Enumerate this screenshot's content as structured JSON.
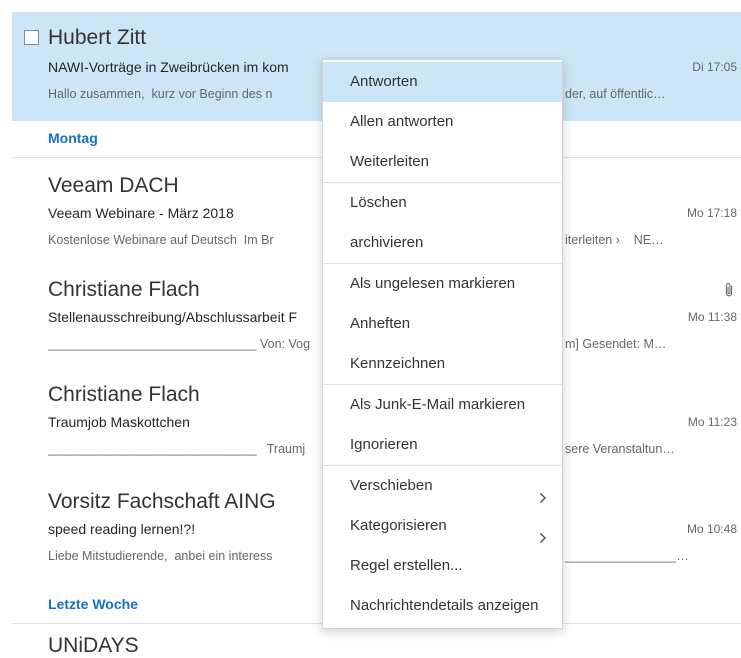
{
  "colors": {
    "accent": "#1570c6",
    "selection": "#cde6f7",
    "text": "#333333",
    "muted": "#666666"
  },
  "icons": {
    "attachment": "paperclip-icon",
    "submenu": "chevron-right-icon"
  },
  "message_list": {
    "selected_message": {
      "sender": "Hubert Zitt",
      "subject": "NAWI-Vorträge in Zweibrücken im kom",
      "time": "Di 17:05",
      "preview": "Hallo zusammen,  kurz vor Beginn des n",
      "preview_tail": "der, auf öffentlic…"
    },
    "groups": [
      {
        "label": "Montag",
        "messages": [
          {
            "sender": "Veeam DACH",
            "subject": "Veeam Webinare - März 2018",
            "time": "Mo 17:18",
            "preview": "Kostenlose Webinare auf Deutsch  Im Br",
            "preview_tail": "iterleiten ›    NE…"
          },
          {
            "sender": "Christiane Flach",
            "subject": "Stellenausschreibung/Abschlussarbeit F",
            "time": "Mo 11:38",
            "preview": "______________________________ Von: Vog",
            "preview_tail": "m] Gesendet: M…",
            "has_attachment": true
          },
          {
            "sender": "Christiane Flach",
            "subject": "Traumjob Maskottchen",
            "time": "Mo 11:23",
            "preview": "______________________________   Traumj",
            "preview_tail": "sere Veranstaltun…"
          },
          {
            "sender": "Vorsitz Fachschaft AING",
            "subject": "speed reading lernen!?!",
            "time": "Mo 10:48",
            "preview": "Liebe Mitstudierende,  anbei ein interess",
            "preview_tail": "________________…"
          }
        ]
      },
      {
        "label": "Letzte Woche",
        "messages": [
          {
            "sender": "UNiDAYS"
          }
        ]
      }
    ]
  },
  "context_menu": {
    "items": [
      {
        "label": "Antworten"
      },
      {
        "label": "Allen antworten"
      },
      {
        "label": "Weiterleiten"
      },
      {
        "label": "Löschen"
      },
      {
        "label": "archivieren"
      },
      {
        "label": "Als ungelesen markieren"
      },
      {
        "label": "Anheften"
      },
      {
        "label": "Kennzeichnen"
      },
      {
        "label": "Als Junk-E-Mail markieren"
      },
      {
        "label": "Ignorieren"
      },
      {
        "label": "Verschieben",
        "submenu_icon": "chevron-right-icon"
      },
      {
        "label": "Kategorisieren",
        "submenu_icon": "chevron-right-icon"
      },
      {
        "label": "Regel erstellen..."
      },
      {
        "label": "Nachrichtendetails anzeigen"
      }
    ]
  }
}
